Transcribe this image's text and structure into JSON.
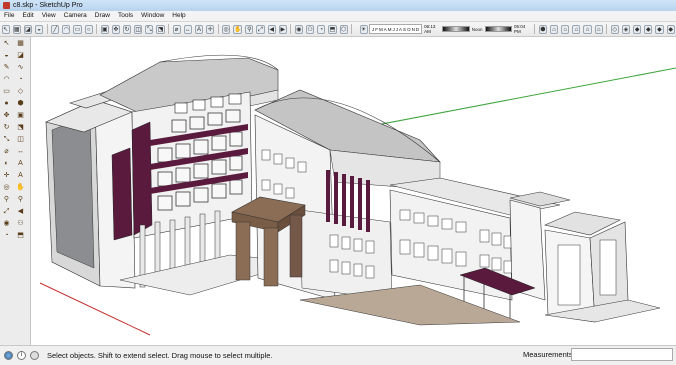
{
  "window": {
    "title": "c8.skp - SketchUp Pro"
  },
  "menu": [
    "File",
    "Edit",
    "View",
    "Camera",
    "Draw",
    "Tools",
    "Window",
    "Help"
  ],
  "toolbar": {
    "left_tools": [
      "select-arrow",
      "component",
      "eraser",
      "paint-bucket",
      "line",
      "arc",
      "rectangle",
      "circle",
      "push-pull",
      "move",
      "rotate",
      "offset",
      "scale",
      "follow-me",
      "tape-measure",
      "dimension",
      "text",
      "axes",
      "orbit",
      "pan",
      "zoom",
      "zoom-extents",
      "previous-view",
      "next-view",
      "camera",
      "walk",
      "look-around"
    ],
    "shadow_months": [
      "J",
      "F",
      "M",
      "A",
      "M",
      "J",
      "J",
      "A",
      "S",
      "O",
      "N",
      "D"
    ],
    "time_start": "06:13 AM",
    "time_noon": "Noon",
    "time_end": "05:04 PM",
    "right_views": [
      "iso",
      "top",
      "front",
      "right",
      "back",
      "left",
      "section",
      "xray",
      "wireframe",
      "hidden-line",
      "shaded",
      "textured",
      "monochrome"
    ]
  },
  "left_toolbar": [
    "arrow",
    "component",
    "paint",
    "eraser",
    "pencil",
    "arc",
    "rectangle",
    "circle",
    "polygon",
    "freehand",
    "move",
    "push-pull",
    "rotate",
    "follow-me",
    "scale",
    "offset",
    "tape",
    "dimension",
    "protractor",
    "text",
    "axes",
    "3d-text",
    "orbit",
    "pan",
    "zoom",
    "zoom-window",
    "zoom-extents",
    "prev",
    "position-camera",
    "walk",
    "look-around",
    "section-plane",
    "sandbox",
    "add-location",
    "share",
    "component-2"
  ],
  "status": {
    "message": "Select objects. Shift to extend select. Drag mouse to select multiple.",
    "measurements_label": "Measurements"
  },
  "colors": {
    "accent_purple": "#5a1a3e",
    "roof_gray": "#c9c9c9",
    "wall_white": "#f2f2f2",
    "entrance_brown": "#8b6d55",
    "axis_green": "#3fa53f",
    "axis_red": "#c83232"
  }
}
